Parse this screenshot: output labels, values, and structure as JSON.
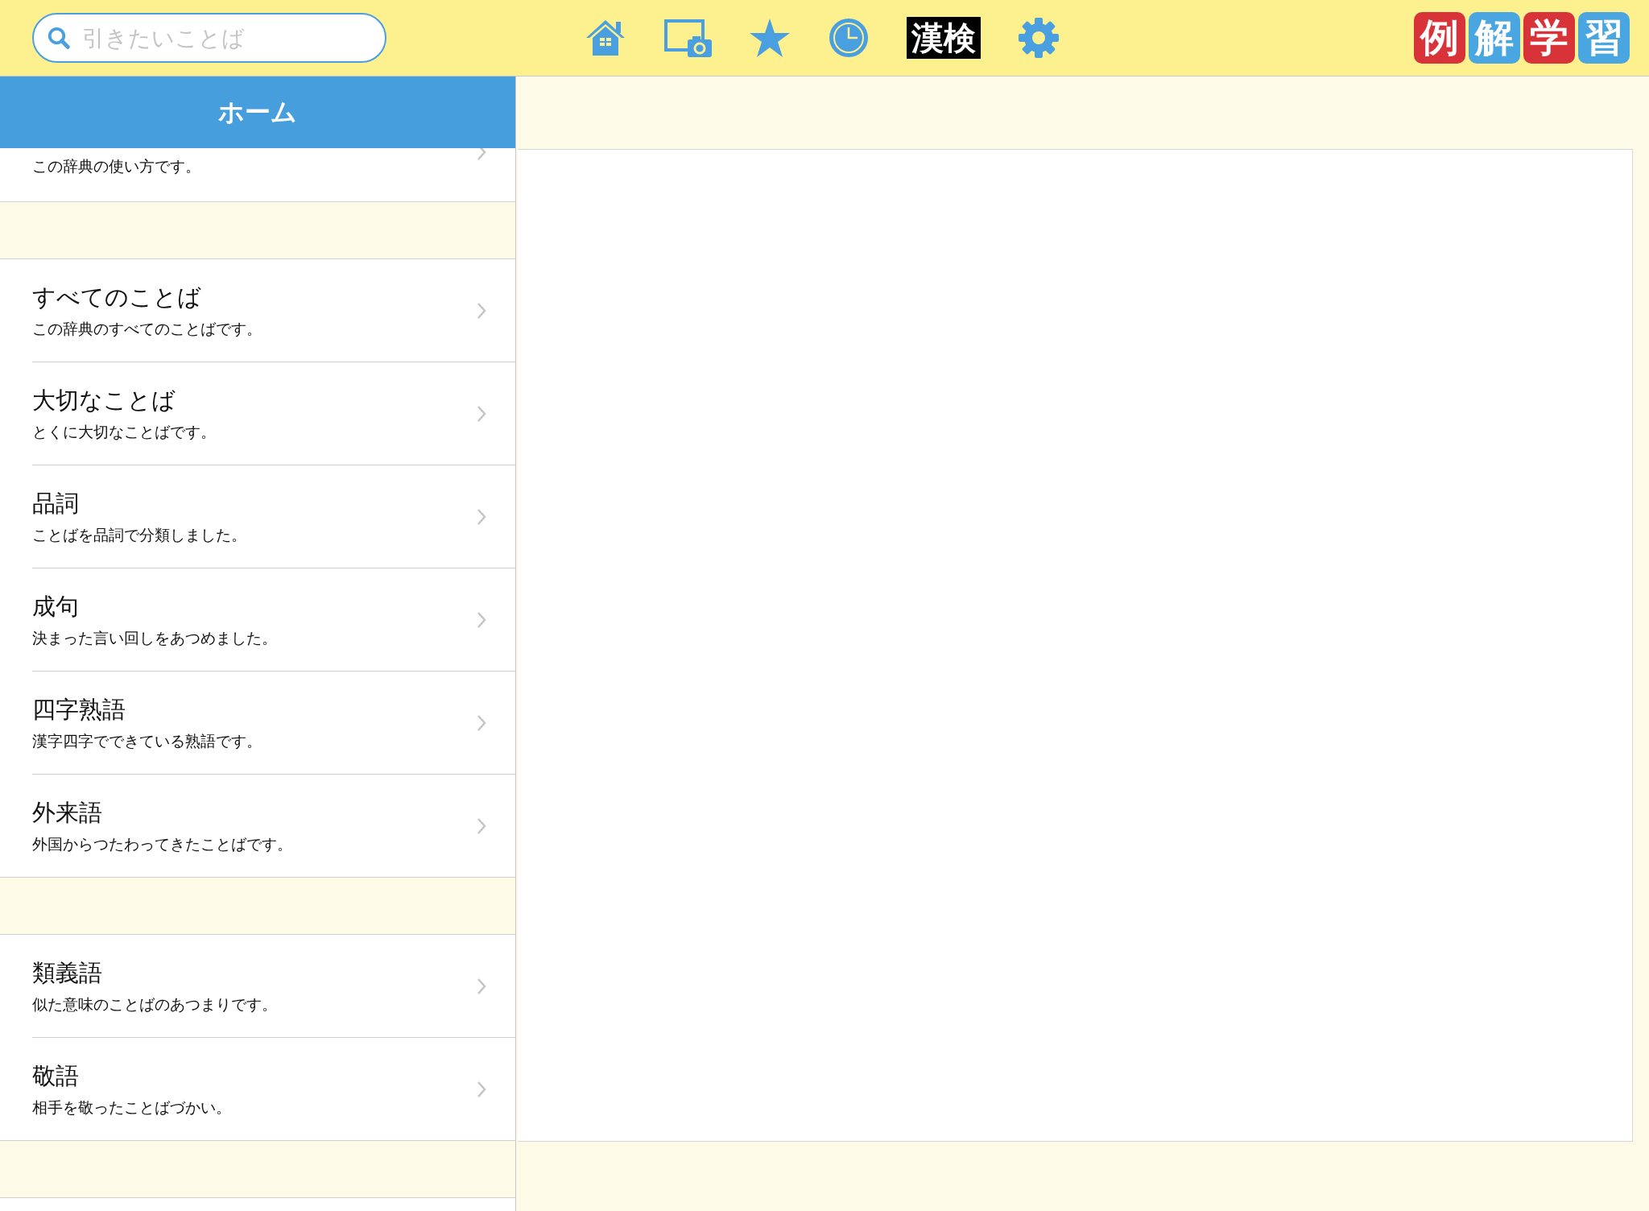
{
  "search": {
    "placeholder": "引きたいことば"
  },
  "toolbar": {
    "kanken_label": "漢検"
  },
  "logo": [
    {
      "char": "例",
      "color": "#d9333a"
    },
    {
      "char": "解",
      "color": "#4aa6e0"
    },
    {
      "char": "学",
      "color": "#d9333a"
    },
    {
      "char": "習",
      "color": "#4aa6e0"
    }
  ],
  "header": {
    "title": "ホーム"
  },
  "sections": [
    {
      "items": [
        {
          "subtitle": "この辞典の使い方です。"
        }
      ]
    },
    {
      "items": [
        {
          "title": "すべてのことば",
          "subtitle": "この辞典のすべてのことばです。"
        },
        {
          "title": "大切なことば",
          "subtitle": "とくに大切なことばです。"
        },
        {
          "title": "品詞",
          "subtitle": "ことばを品詞で分類しました。"
        },
        {
          "title": "成句",
          "subtitle": "決まった言い回しをあつめました。"
        },
        {
          "title": "四字熟語",
          "subtitle": "漢字四字でできている熟語です。"
        },
        {
          "title": "外来語",
          "subtitle": "外国からつたわってきたことばです。"
        }
      ]
    },
    {
      "items": [
        {
          "title": "類義語",
          "subtitle": "似た意味のことばのあつまりです。"
        },
        {
          "title": "敬語",
          "subtitle": "相手を敬ったことばづかい。"
        }
      ]
    }
  ]
}
